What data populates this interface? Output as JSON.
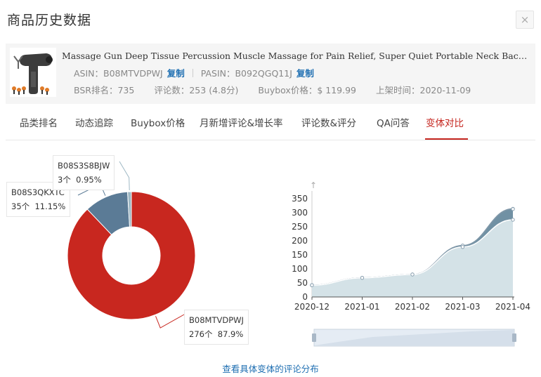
{
  "dialog": {
    "title": "商品历史数据",
    "close_label": "×"
  },
  "product": {
    "name": "Massage Gun Deep Tissue Percussion Muscle Massage for Pain Relief, Super Quiet Portable Neck Back Body Relax Massager",
    "asin_label": "ASIN：",
    "asin": "B08MTVDPWJ",
    "pasin_label": "PASIN：",
    "pasin": "B092QGQ11J",
    "copy_label": "复制",
    "bsr_label": "BSR排名：",
    "bsr": "735",
    "reviews_label": "评论数：",
    "reviews": "253 (4.8分)",
    "buybox_label": "Buybox价格：",
    "buybox": "$ 119.99",
    "date_label": "上架时间：",
    "date": "2020-11-09"
  },
  "tabs": [
    {
      "label": "品类排名"
    },
    {
      "label": "动态追踪"
    },
    {
      "label": "Buybox价格"
    },
    {
      "label": "月新增评论&增长率"
    },
    {
      "label": "评论数&评分"
    },
    {
      "label": "QA问答"
    },
    {
      "label": "变体对比"
    }
  ],
  "active_tab": 6,
  "colors": {
    "accent": "#c5261f",
    "link": "#1f6fb2",
    "area": "#8fbcc4",
    "slice1": "#c8271f",
    "slice2": "#5b7b96",
    "slice3": "#9eb8c4"
  },
  "chart_data": [
    {
      "type": "pie",
      "donut": true,
      "slices": [
        {
          "name": "B08MTVDPWJ",
          "count_label": "276个",
          "value": 276,
          "percent": "87.9%"
        },
        {
          "name": "B08S3QKXTC",
          "count_label": "35个",
          "value": 35,
          "percent": "11.15%"
        },
        {
          "name": "B08S3S8BJW",
          "count_label": "3个",
          "value": 3,
          "percent": "0.95%"
        }
      ]
    },
    {
      "type": "area",
      "categories": [
        "2020-12",
        "2021-01",
        "2021-02",
        "2021-03",
        "2021-04"
      ],
      "series": [
        {
          "values": [
            42,
            68,
            80,
            178,
            275
          ]
        },
        {
          "values": [
            42,
            68,
            80,
            183,
            313
          ]
        },
        {
          "values": [
            42,
            68,
            80,
            183,
            314
          ]
        }
      ],
      "yticks": [
        0,
        50,
        100,
        150,
        200,
        250,
        300,
        350
      ],
      "ylim": [
        0,
        350
      ]
    }
  ],
  "footer": {
    "link_label": "查看具体变体的评论分布"
  }
}
